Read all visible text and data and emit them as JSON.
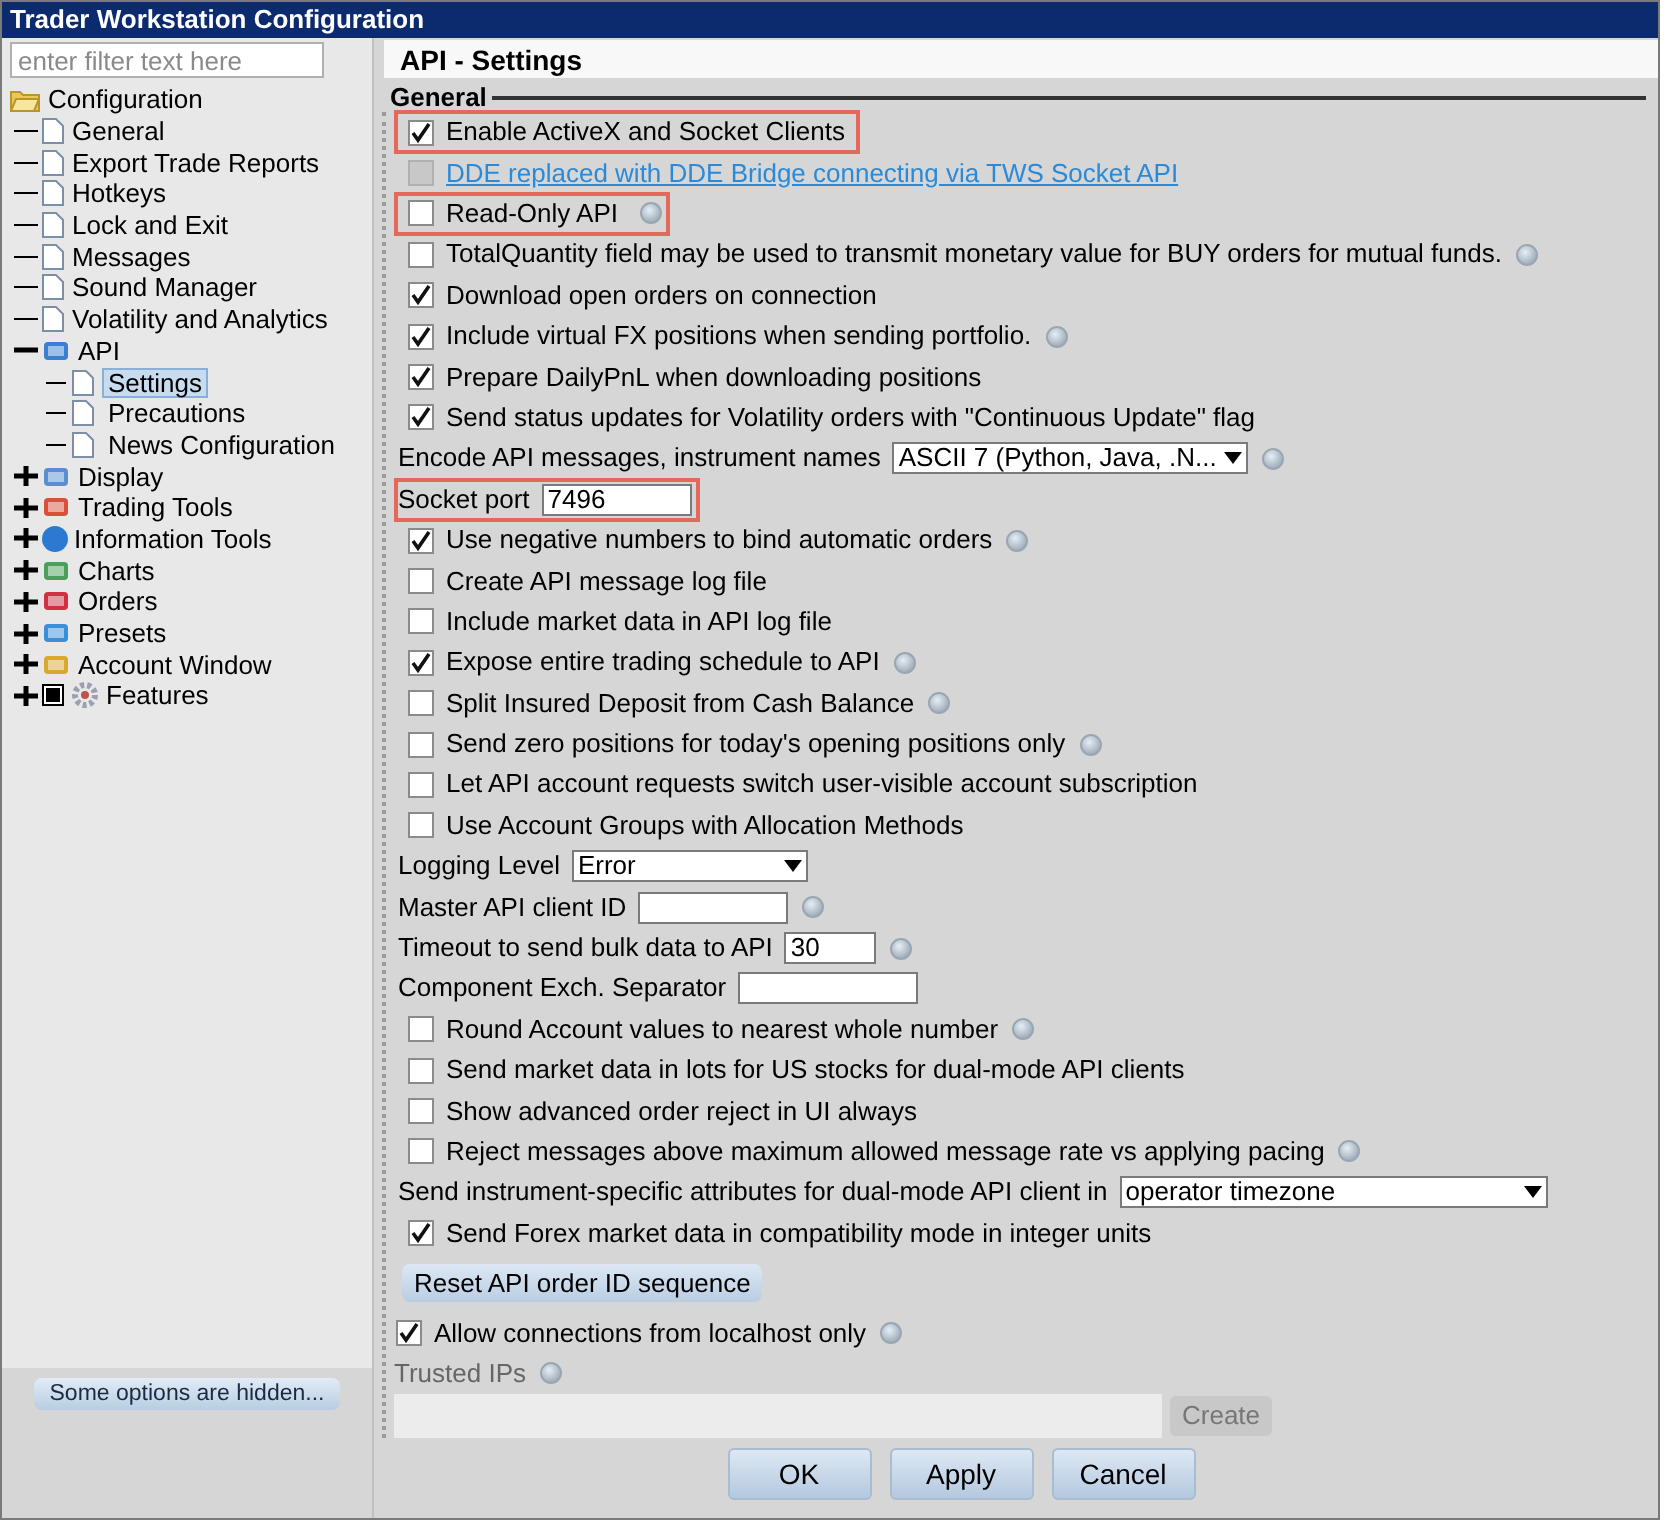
{
  "window": {
    "title": "Trader Workstation Configuration"
  },
  "sidebar": {
    "filter": {
      "placeholder": "enter filter text here"
    },
    "tree": {
      "label": "Configuration",
      "expanded": true,
      "children": [
        {
          "label": "General"
        },
        {
          "label": "Export Trade Reports"
        },
        {
          "label": "Hotkeys"
        },
        {
          "label": "Lock and Exit"
        },
        {
          "label": "Messages"
        },
        {
          "label": "Sound Manager"
        },
        {
          "label": "Volatility and Analytics"
        },
        {
          "label": "API",
          "expanded": true,
          "children": [
            {
              "label": "Settings",
              "selected": true
            },
            {
              "label": "Precautions",
              "selected": false
            },
            {
              "label": "News Configuration",
              "selected": false
            }
          ]
        },
        {
          "label": "Display",
          "expanded": false
        },
        {
          "label": "Trading Tools",
          "expanded": false
        },
        {
          "label": "Information Tools",
          "expanded": false
        },
        {
          "label": "Charts",
          "expanded": false
        },
        {
          "label": "Orders",
          "expanded": false
        },
        {
          "label": "Presets",
          "expanded": false
        },
        {
          "label": "Account Window",
          "expanded": false
        },
        {
          "label": "Features",
          "expanded": false
        }
      ]
    },
    "hidden_button": "Some options are hidden..."
  },
  "panel": {
    "title": "API - Settings",
    "section": "General",
    "rows": [
      {
        "kind": "checkbox",
        "label": "Enable ActiveX and Socket Clients",
        "checked": true,
        "info": false,
        "highlighted": true
      },
      {
        "kind": "link",
        "label": "DDE replaced with DDE Bridge connecting via TWS Socket API",
        "checked": false,
        "disabled": true
      },
      {
        "kind": "checkbox",
        "label": "Read-Only API",
        "checked": false,
        "info": true,
        "highlighted": true
      },
      {
        "kind": "checkbox",
        "label": "TotalQuantity field may be used to transmit monetary value for BUY orders for mutual funds.",
        "checked": false,
        "info": true,
        "highlighted": false
      },
      {
        "kind": "checkbox",
        "label": "Download open orders on connection",
        "checked": true,
        "info": false,
        "highlighted": false
      },
      {
        "kind": "checkbox",
        "label": "Include virtual FX positions when sending portfolio.",
        "checked": true,
        "info": true,
        "highlighted": false
      },
      {
        "kind": "checkbox",
        "label": "Prepare DailyPnL when downloading positions",
        "checked": true,
        "info": false,
        "highlighted": false
      },
      {
        "kind": "checkbox",
        "label": "Send status updates for Volatility orders with \"Continuous Update\" flag",
        "checked": true,
        "info": false,
        "highlighted": false
      },
      {
        "kind": "select",
        "label": "Encode API messages, instrument names",
        "value": "ASCII 7 (Python, Java, .N...",
        "info": true,
        "highlighted": false
      },
      {
        "kind": "text",
        "label": "Socket port",
        "value": "7496",
        "info": false,
        "highlighted": true
      },
      {
        "kind": "checkbox",
        "label": "Use negative numbers to bind automatic orders",
        "checked": true,
        "info": true,
        "highlighted": false
      },
      {
        "kind": "checkbox",
        "label": "Create API message log file",
        "checked": false,
        "info": false,
        "highlighted": false
      },
      {
        "kind": "checkbox",
        "label": "Include market data in API log file",
        "checked": false,
        "info": false,
        "highlighted": false
      },
      {
        "kind": "checkbox",
        "label": "Expose entire trading schedule to API",
        "checked": true,
        "info": true,
        "highlighted": false
      },
      {
        "kind": "checkbox",
        "label": "Split Insured Deposit from Cash Balance",
        "checked": false,
        "info": true,
        "highlighted": false
      },
      {
        "kind": "checkbox",
        "label": "Send zero positions for today's opening positions only",
        "checked": false,
        "info": true,
        "highlighted": false
      },
      {
        "kind": "checkbox",
        "label": "Let API account requests switch user-visible account subscription",
        "checked": false,
        "info": false,
        "highlighted": false
      },
      {
        "kind": "checkbox",
        "label": "Use Account Groups with Allocation Methods",
        "checked": false,
        "info": false,
        "highlighted": false
      },
      {
        "kind": "select",
        "label": "Logging Level",
        "value": "Error",
        "info": false,
        "highlighted": false
      },
      {
        "kind": "text",
        "label": "Master API client ID",
        "info": true,
        "highlighted": false
      },
      {
        "kind": "text",
        "label": "Timeout to send bulk data to API",
        "value": "30",
        "info": true,
        "highlighted": false
      },
      {
        "kind": "text",
        "label": "Component Exch. Separator",
        "info": false,
        "highlighted": false
      },
      {
        "kind": "checkbox",
        "label": "Round Account values to nearest whole number",
        "checked": false,
        "info": true,
        "highlighted": false
      },
      {
        "kind": "checkbox",
        "label": "Send market data in lots for US stocks for dual-mode API clients",
        "checked": false,
        "info": false,
        "highlighted": false
      },
      {
        "kind": "checkbox",
        "label": "Show advanced order reject in UI always",
        "checked": false,
        "info": false,
        "highlighted": false
      },
      {
        "kind": "checkbox",
        "label": "Reject messages above maximum allowed message rate vs applying pacing",
        "checked": false,
        "info": true,
        "highlighted": false
      },
      {
        "kind": "select",
        "label": "Send instrument-specific attributes for dual-mode API client in",
        "value": "operator timezone",
        "info": false,
        "highlighted": false
      },
      {
        "kind": "checkbox",
        "label": "Send Forex market data in compatibility mode in integer units",
        "checked": true,
        "info": false,
        "highlighted": false
      }
    ],
    "reset_button": "Reset API order ID sequence",
    "localhost": {
      "label": "Allow connections from localhost only",
      "checked": true,
      "info": true
    },
    "trusted_ips": {
      "label": "Trusted IPs",
      "info": true,
      "create_button": "Create",
      "create_disabled": true
    }
  },
  "buttons": [
    "OK",
    "Apply",
    "Cancel"
  ]
}
